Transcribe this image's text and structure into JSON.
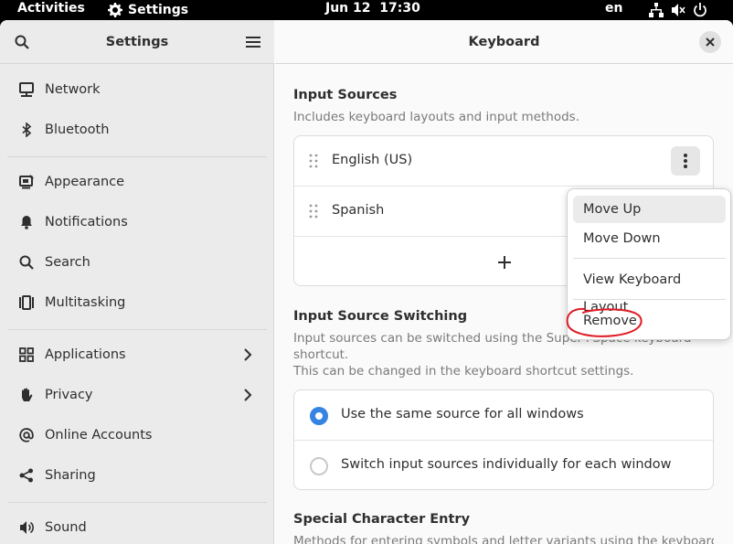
{
  "topbar": {
    "activities": "Activities",
    "app_name": "Settings",
    "clock": "Jun 12  17:30",
    "language": "en"
  },
  "sidebar": {
    "title": "Settings",
    "items": [
      {
        "label": "Network",
        "icon": "network-icon"
      },
      {
        "label": "Bluetooth",
        "icon": "bluetooth-icon"
      },
      {
        "label": "Appearance",
        "icon": "appearance-icon"
      },
      {
        "label": "Notifications",
        "icon": "bell-icon"
      },
      {
        "label": "Search",
        "icon": "search-icon"
      },
      {
        "label": "Multitasking",
        "icon": "multitasking-icon"
      },
      {
        "label": "Applications",
        "icon": "grid-icon"
      },
      {
        "label": "Privacy",
        "icon": "hand-icon"
      },
      {
        "label": "Online Accounts",
        "icon": "at-icon"
      },
      {
        "label": "Sharing",
        "icon": "share-icon"
      },
      {
        "label": "Sound",
        "icon": "speaker-icon"
      }
    ]
  },
  "main": {
    "title": "Keyboard",
    "input_sources": {
      "title": "Input Sources",
      "description": "Includes keyboard layouts and input methods.",
      "sources": [
        "English (US)",
        "Spanish"
      ]
    },
    "switching": {
      "title": "Input Source Switching",
      "description_line1": "Input sources can be switched using the Super+Space keyboard",
      "description_line2": "shortcut.",
      "description_line3": "This can be changed in the keyboard shortcut settings.",
      "options": [
        {
          "label": "Use the same source for all windows",
          "selected": true
        },
        {
          "label": "Switch input sources individually for each window",
          "selected": false
        }
      ]
    },
    "special_chars": {
      "title": "Special Character Entry",
      "description": "Methods for entering symbols and letter variants using the keyboard."
    }
  },
  "popover": {
    "items": [
      "Move Up",
      "Move Down",
      "View Keyboard Layout",
      "Remove"
    ]
  },
  "colors": {
    "accent": "#3584e4",
    "annotation": "#e01b24"
  }
}
